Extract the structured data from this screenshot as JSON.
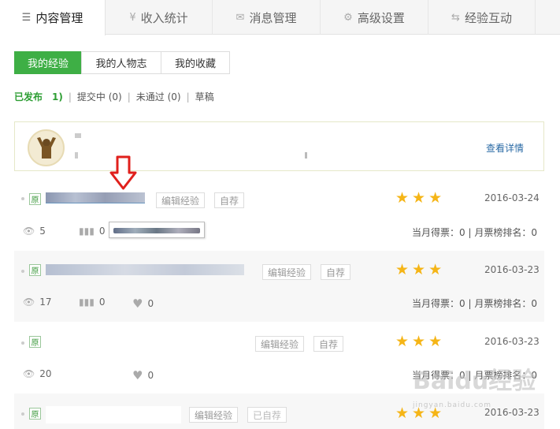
{
  "topnav": {
    "tabs": [
      {
        "label": "内容管理",
        "icon": "list-icon",
        "glyph": "☰",
        "active": true
      },
      {
        "label": "收入统计",
        "icon": "yen-icon",
        "glyph": "¥",
        "active": false
      },
      {
        "label": "消息管理",
        "icon": "mail-icon",
        "glyph": "✉",
        "active": false
      },
      {
        "label": "高级设置",
        "icon": "gear-icon",
        "glyph": "⚙",
        "active": false
      },
      {
        "label": "经验互动",
        "icon": "exchange-icon",
        "glyph": "⇆",
        "active": false
      }
    ]
  },
  "subtabs": [
    {
      "label": "我的经验",
      "active": true
    },
    {
      "label": "我的人物志",
      "active": false
    },
    {
      "label": "我的收藏",
      "active": false
    }
  ],
  "filters": {
    "published": "已发布",
    "published_count": "1)",
    "submitting": "提交中 (0)",
    "rejected": "未通过 (0)",
    "draft": "草稿"
  },
  "card": {
    "detail_link": "查看详情",
    "accent_color": "#2a6aa5"
  },
  "rows": [
    {
      "orig": "原",
      "edit": "编辑经验",
      "self_rec": "自荐",
      "date": "2016-03-24",
      "views": "5",
      "bars": "0",
      "votes": "当月得票：0 | 月票榜排名：0"
    },
    {
      "orig": "原",
      "edit": "编辑经验",
      "self_rec": "自荐",
      "date": "2016-03-23",
      "views": "17",
      "bars": "0",
      "likes": "0",
      "votes": "当月得票：0 | 月票榜排名：0"
    },
    {
      "orig": "原",
      "edit": "编辑经验",
      "self_rec": "自荐",
      "date": "2016-03-23",
      "views": "20",
      "likes": "0",
      "votes": "当月得票：0 | 月票榜排名：0"
    },
    {
      "orig": "原",
      "edit": "编辑经验",
      "self_rec": "已自荐",
      "date": "2016-03-23"
    }
  ],
  "stars": 3,
  "colors": {
    "primary_green": "#3eaf45",
    "star": "#f5b517",
    "link": "#2a6aa5",
    "arrow": "#e0201c"
  },
  "watermark": {
    "text": "Baidu经验",
    "sub": "jingyan.baidu.com"
  }
}
